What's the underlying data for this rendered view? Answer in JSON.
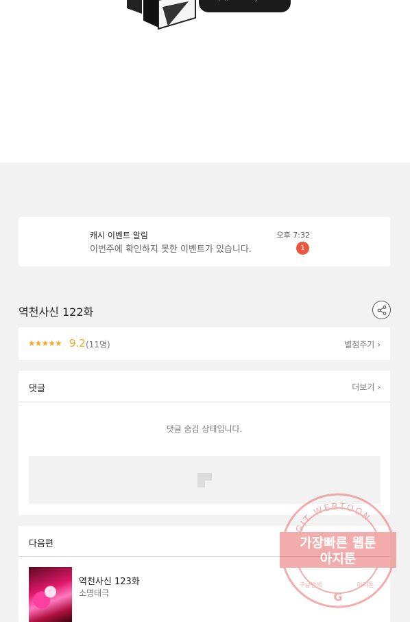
{
  "notification": {
    "title": "캐시 이벤트 알림",
    "message": "이번주에 확인하지 못한 이벤트가 있습니다.",
    "time": "오후 7:32",
    "badge": "1"
  },
  "episode": {
    "title": "역천사신 122화",
    "stars": "★★★★★",
    "score": "9.2",
    "count": "(11명)",
    "rate_link": "별점주기",
    "share_icon": "share-icon"
  },
  "comments": {
    "title": "댓글",
    "more": "더보기",
    "hidden_message": "댓글 숨김 상태입니다."
  },
  "next": {
    "header": "다음편",
    "episode_title": "역천사신 123화",
    "author": "소명태극"
  },
  "watermark": {
    "top_text": "AGIT WEBTOON",
    "line1": "가장빠른 웹툰",
    "line2": "아지툰",
    "bottom_left": "구글검색",
    "bottom_right": "아지툰",
    "color": "#e86a6a"
  },
  "colors": {
    "accent": "#f5a623",
    "badge": "#e9573d"
  }
}
